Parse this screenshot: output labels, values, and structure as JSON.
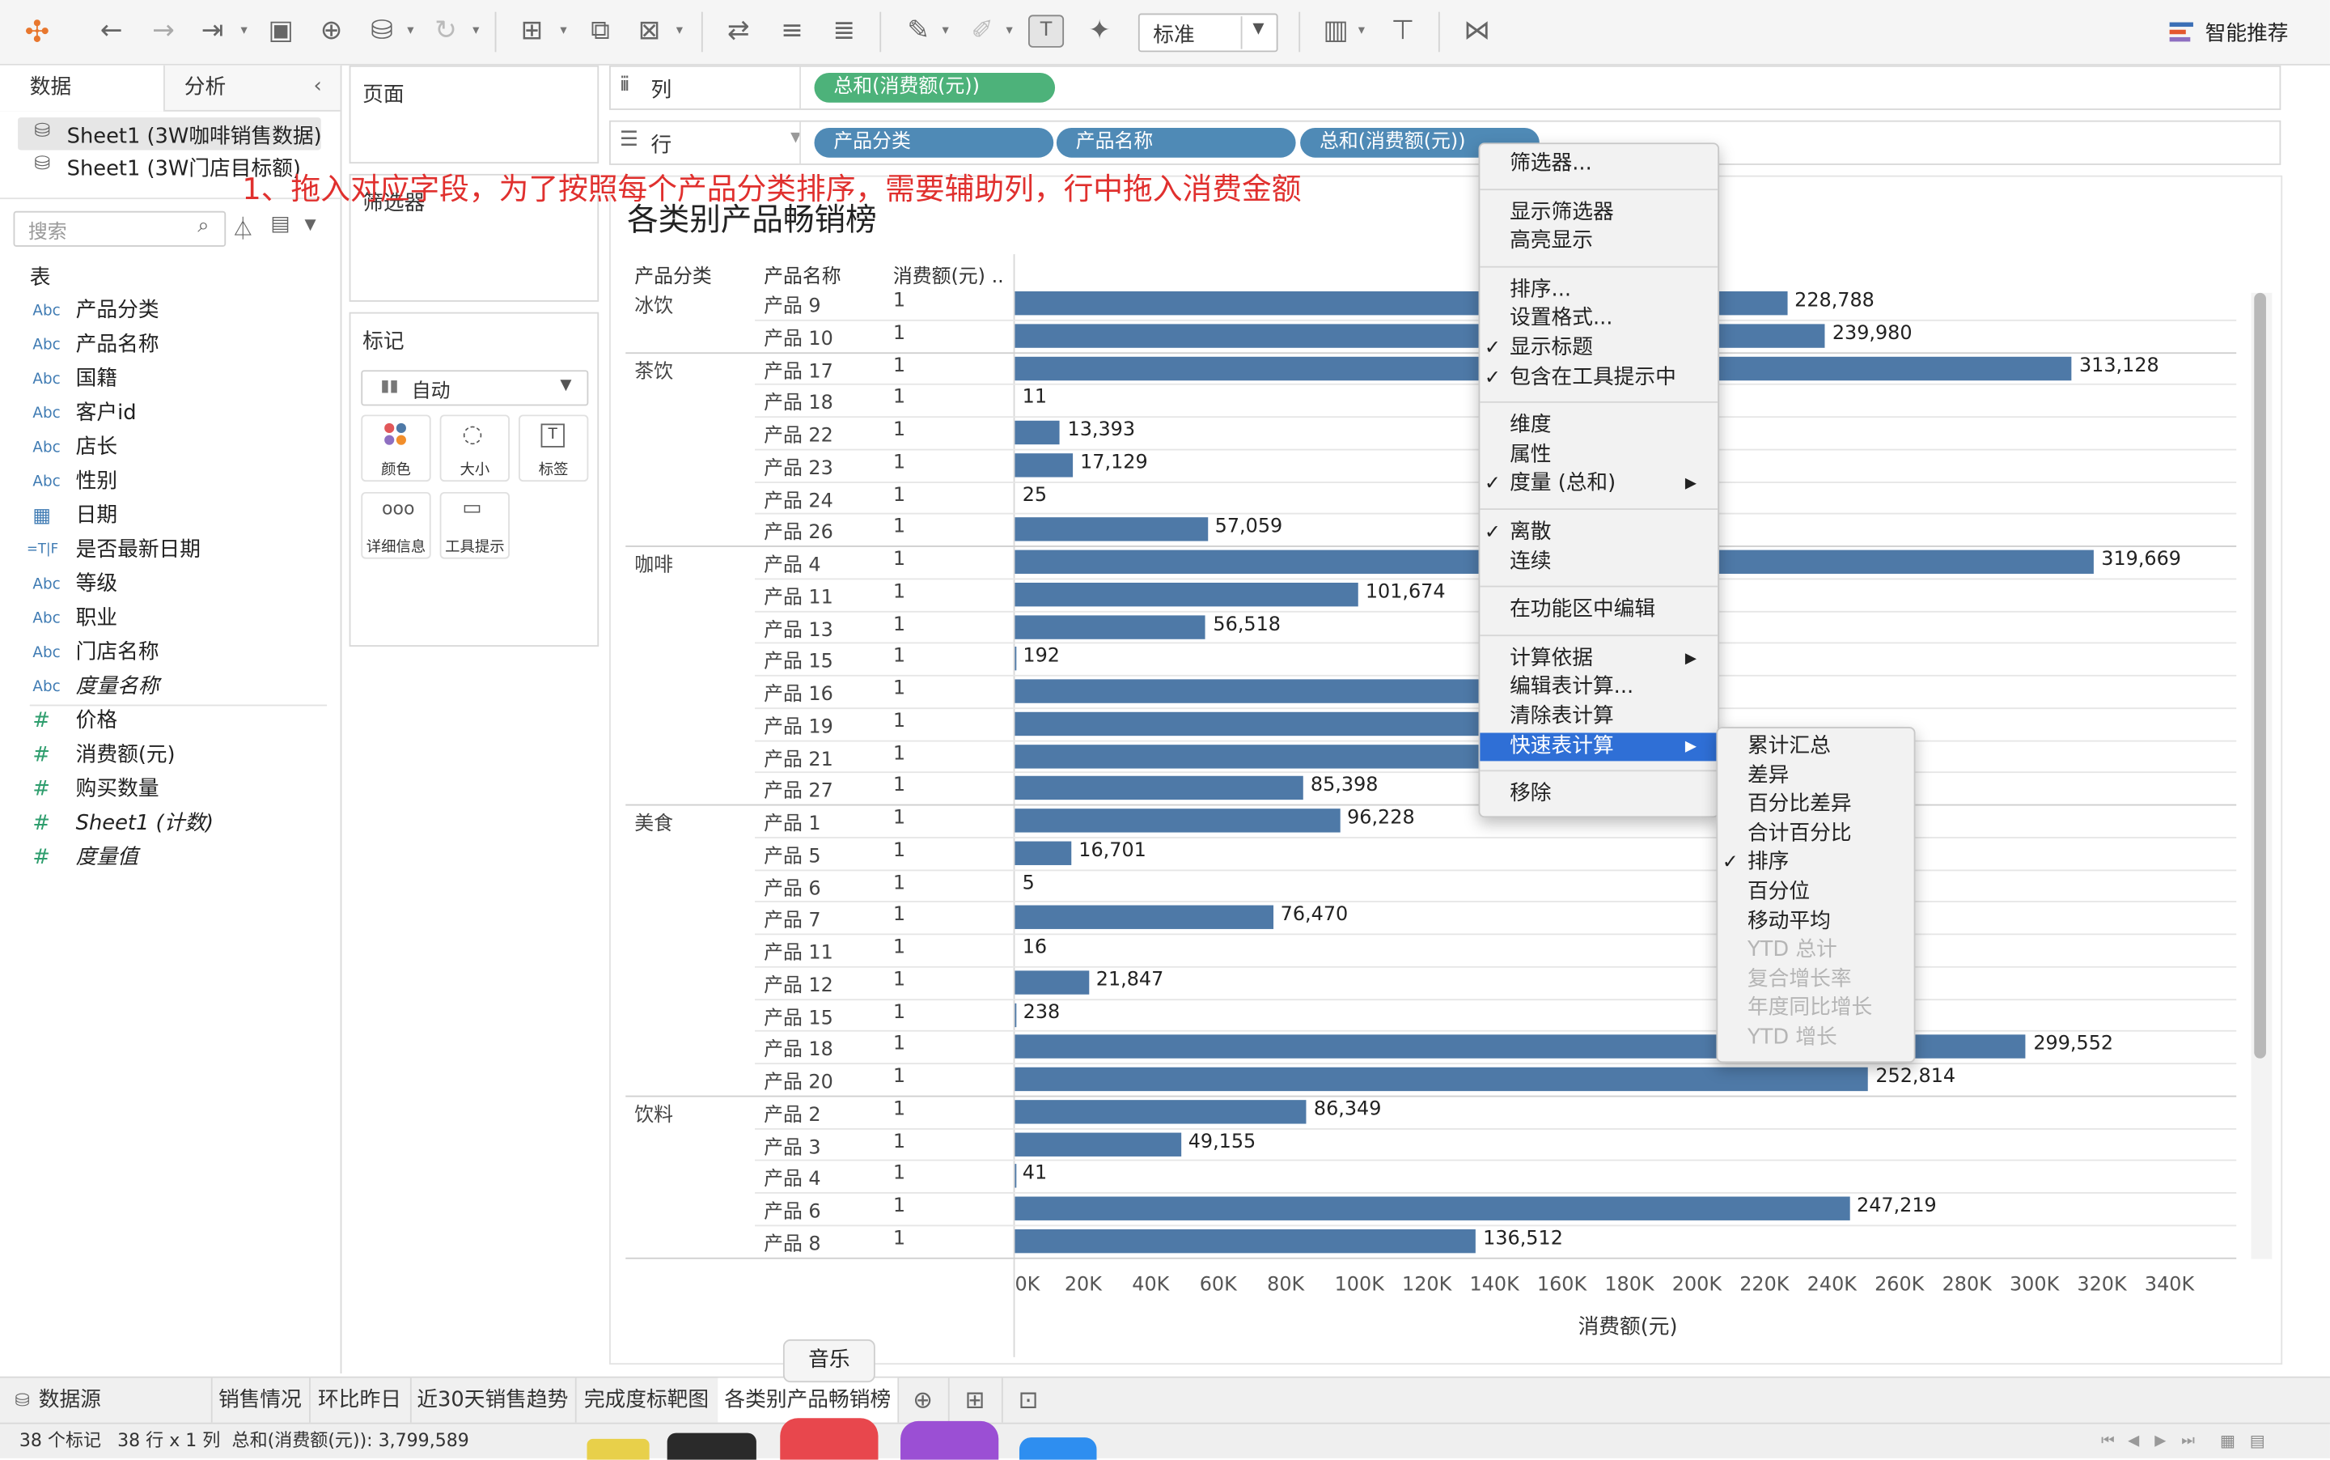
{
  "toolbar": {
    "style_select": "标准",
    "smart_recommend": "智能推荐",
    "icons": [
      "tableau-logo-icon",
      "back-icon",
      "forward-icon",
      "redo-icon",
      "save-icon",
      "new-datasource-icon",
      "datasource-icon",
      "refresh-icon",
      "new-worksheet-icon",
      "duplicate-icon",
      "clear-icon",
      "swap-icon",
      "sort-asc-icon",
      "sort-desc-icon",
      "highlight-icon",
      "annotate-icon",
      "text-label-icon",
      "pin-icon",
      "show-me-icon",
      "presentation-icon",
      "share-icon"
    ]
  },
  "left": {
    "tabs": [
      "数据",
      "分析"
    ],
    "datasources": [
      "Sheet1 (3W咖啡销售数据)",
      "Sheet1 (3W门店目标额)"
    ],
    "search_placeholder": "搜索",
    "table_header": "表",
    "fields": [
      {
        "type": "Abc",
        "name": "产品分类",
        "italic": false
      },
      {
        "type": "Abc",
        "name": "产品名称",
        "italic": false
      },
      {
        "type": "Abc",
        "name": "国籍",
        "italic": false
      },
      {
        "type": "Abc",
        "name": "客户id",
        "italic": false
      },
      {
        "type": "Abc",
        "name": "店长",
        "italic": false
      },
      {
        "type": "Abc",
        "name": "性别",
        "italic": false
      },
      {
        "type": "date",
        "name": "日期",
        "italic": false
      },
      {
        "type": "=T|F",
        "name": "是否最新日期",
        "italic": false
      },
      {
        "type": "Abc",
        "name": "等级",
        "italic": false
      },
      {
        "type": "Abc",
        "name": "职业",
        "italic": false
      },
      {
        "type": "Abc",
        "name": "门店名称",
        "italic": false
      },
      {
        "type": "Abc",
        "name": "度量名称",
        "italic": true
      },
      {
        "type": "#",
        "name": "价格",
        "italic": false
      },
      {
        "type": "#",
        "name": "消费额(元)",
        "italic": false
      },
      {
        "type": "#",
        "name": "购买数量",
        "italic": false
      },
      {
        "type": "#",
        "name": "Sheet1 (计数)",
        "italic": true
      },
      {
        "type": "#",
        "name": "度量值",
        "italic": true
      }
    ]
  },
  "cards": {
    "pages": "页面",
    "filters": "筛选器",
    "marks": "标记",
    "mark_type": "自动",
    "mark_buttons": [
      "颜色",
      "大小",
      "标签",
      "详细信息",
      "工具提示"
    ]
  },
  "shelves": {
    "columns_label": "列",
    "rows_label": "行",
    "columns_pills": [
      "总和(消费额(元))"
    ],
    "rows_pills": [
      "产品分类",
      "产品名称",
      "总和(消费额(元))"
    ]
  },
  "annotation": "1、拖入对应字段，为了按照每个产品分类排序，需要辅助列，行中拖入消费金额",
  "chart_data": {
    "type": "bar",
    "title": "各类别产品畅销榜",
    "headers": [
      "产品分类",
      "产品名称",
      "消费额(元) .."
    ],
    "xlabel": "消费额(元)",
    "xlim": [
      0,
      350000
    ],
    "xticks": [
      "0K",
      "20K",
      "40K",
      "60K",
      "80K",
      "100K",
      "120K",
      "140K",
      "160K",
      "180K",
      "200K",
      "220K",
      "240K",
      "260K",
      "280K",
      "300K",
      "320K",
      "340K"
    ],
    "groups": [
      {
        "category": "冰饮",
        "rows": [
          {
            "product": "产品 9",
            "aux": "1",
            "value": 228788,
            "label": "228,788"
          },
          {
            "product": "产品 10",
            "aux": "1",
            "value": 239980,
            "label": "239,980"
          }
        ]
      },
      {
        "category": "茶饮",
        "rows": [
          {
            "product": "产品 17",
            "aux": "1",
            "value": 313128,
            "label": "313,128"
          },
          {
            "product": "产品 18",
            "aux": "1",
            "value": 11,
            "label": "11"
          },
          {
            "product": "产品 22",
            "aux": "1",
            "value": 13393,
            "label": "13,393"
          },
          {
            "product": "产品 23",
            "aux": "1",
            "value": 17129,
            "label": "17,129"
          },
          {
            "product": "产品 24",
            "aux": "1",
            "value": 25,
            "label": "25"
          },
          {
            "product": "产品 26",
            "aux": "1",
            "value": 57059,
            "label": "57,059"
          }
        ]
      },
      {
        "category": "咖啡",
        "rows": [
          {
            "product": "产品 4",
            "aux": "1",
            "value": 319669,
            "label": "319,669"
          },
          {
            "product": "产品 11",
            "aux": "1",
            "value": 101674,
            "label": "101,674"
          },
          {
            "product": "产品 13",
            "aux": "1",
            "value": 56518,
            "label": "56,518"
          },
          {
            "product": "产品 15",
            "aux": "1",
            "value": 192,
            "label": "192"
          },
          {
            "product": "产品 16",
            "aux": "1",
            "value": 140000,
            "label": ""
          },
          {
            "product": "产品 19",
            "aux": "1",
            "value": 140000,
            "label": ""
          },
          {
            "product": "产品 21",
            "aux": "1",
            "value": 140000,
            "label": ""
          },
          {
            "product": "产品 27",
            "aux": "1",
            "value": 85398,
            "label": "85,398"
          }
        ]
      },
      {
        "category": "美食",
        "rows": [
          {
            "product": "产品 1",
            "aux": "1",
            "value": 96228,
            "label": "96,228"
          },
          {
            "product": "产品 5",
            "aux": "1",
            "value": 16701,
            "label": "16,701"
          },
          {
            "product": "产品 6",
            "aux": "1",
            "value": 5,
            "label": "5"
          },
          {
            "product": "产品 7",
            "aux": "1",
            "value": 76470,
            "label": "76,470"
          },
          {
            "product": "产品 11",
            "aux": "1",
            "value": 16,
            "label": "16"
          },
          {
            "product": "产品 12",
            "aux": "1",
            "value": 21847,
            "label": "21,847"
          },
          {
            "product": "产品 15",
            "aux": "1",
            "value": 238,
            "label": "238"
          },
          {
            "product": "产品 18",
            "aux": "1",
            "value": 299552,
            "label": "299,552"
          },
          {
            "product": "产品 20",
            "aux": "1",
            "value": 252814,
            "label": "252,814"
          }
        ]
      },
      {
        "category": "饮料",
        "rows": [
          {
            "product": "产品 2",
            "aux": "1",
            "value": 86349,
            "label": "86,349"
          },
          {
            "product": "产品 3",
            "aux": "1",
            "value": 49155,
            "label": "49,155"
          },
          {
            "product": "产品 4",
            "aux": "1",
            "value": 41,
            "label": "41"
          },
          {
            "product": "产品 6",
            "aux": "1",
            "value": 247219,
            "label": "247,219"
          },
          {
            "product": "产品 8",
            "aux": "1",
            "value": 136512,
            "label": "136,512"
          }
        ]
      }
    ]
  },
  "context_menu": {
    "items": [
      {
        "label": "筛选器...",
        "check": false,
        "arrow": false
      },
      {
        "sep": true
      },
      {
        "label": "显示筛选器",
        "check": false,
        "arrow": false
      },
      {
        "label": "高亮显示",
        "check": false,
        "arrow": false
      },
      {
        "sep": true
      },
      {
        "label": "排序...",
        "check": false,
        "arrow": false
      },
      {
        "label": "设置格式...",
        "check": false,
        "arrow": false
      },
      {
        "label": "显示标题",
        "check": true,
        "arrow": false
      },
      {
        "label": "包含在工具提示中",
        "check": true,
        "arrow": false
      },
      {
        "sep": true
      },
      {
        "label": "维度",
        "check": false,
        "arrow": false
      },
      {
        "label": "属性",
        "check": false,
        "arrow": false
      },
      {
        "label": "度量 (总和)",
        "check": true,
        "arrow": true
      },
      {
        "sep": true
      },
      {
        "label": "离散",
        "check": true,
        "arrow": false
      },
      {
        "label": "连续",
        "check": false,
        "arrow": false
      },
      {
        "sep": true
      },
      {
        "label": "在功能区中编辑",
        "check": false,
        "arrow": false
      },
      {
        "sep": true
      },
      {
        "label": "计算依据",
        "check": false,
        "arrow": true
      },
      {
        "label": "编辑表计算...",
        "check": false,
        "arrow": false
      },
      {
        "label": "清除表计算",
        "check": false,
        "arrow": false
      },
      {
        "label": "快速表计算",
        "check": false,
        "arrow": true,
        "highlight": true
      },
      {
        "sep": true
      },
      {
        "label": "移除",
        "check": false,
        "arrow": false
      }
    ]
  },
  "submenu": {
    "items": [
      {
        "label": "累计汇总",
        "check": false,
        "disabled": false
      },
      {
        "label": "差异",
        "check": false,
        "disabled": false
      },
      {
        "label": "百分比差异",
        "check": false,
        "disabled": false
      },
      {
        "label": "合计百分比",
        "check": false,
        "disabled": false
      },
      {
        "label": "排序",
        "check": true,
        "disabled": false
      },
      {
        "label": "百分位",
        "check": false,
        "disabled": false
      },
      {
        "label": "移动平均",
        "check": false,
        "disabled": false
      },
      {
        "label": "YTD 总计",
        "check": false,
        "disabled": true
      },
      {
        "label": "复合增长率",
        "check": false,
        "disabled": true
      },
      {
        "label": "年度同比增长",
        "check": false,
        "disabled": true
      },
      {
        "label": "YTD 增长",
        "check": false,
        "disabled": true
      }
    ]
  },
  "sheet_tabs": {
    "datasource": "数据源",
    "tabs": [
      "销售情况",
      "环比昨日",
      "近30天销售趋势",
      "完成度标靶图",
      "各类别产品畅销榜"
    ],
    "active": "各类别产品畅销榜",
    "tooltip": "音乐"
  },
  "statusbar": {
    "marks": "38 个标记",
    "rows_cols": "38 行 x 1 列",
    "sum": "总和(消费额(元)): 3,799,589"
  },
  "colors": {
    "bar": "#4e79a7",
    "pill_green": "#4db27a",
    "pill_blue": "#4f8ab6",
    "annotation": "#e0302e",
    "menu_highlight": "#2f6fd6"
  }
}
